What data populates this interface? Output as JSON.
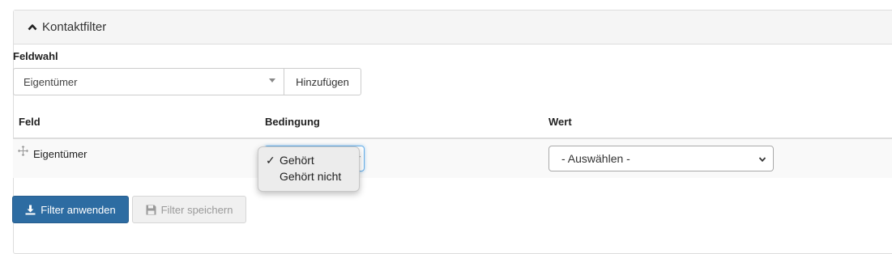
{
  "panel": {
    "title": "Kontaktfilter",
    "header_icon": "chevron-up-icon"
  },
  "field_select": {
    "label": "Feldwahl",
    "value": "Eigentümer",
    "add_button": "Hinzufügen"
  },
  "table": {
    "headers": {
      "feld": "Feld",
      "bedingung": "Bedingung",
      "wert": "Wert"
    },
    "rows": [
      {
        "feld": "Eigentümer",
        "bedingung_options": [
          "Gehört",
          "Gehört nicht"
        ],
        "bedingung_selected": "Gehört",
        "wert": "- Auswählen -"
      }
    ]
  },
  "buttons": {
    "apply": "Filter anwenden",
    "save": "Filter speichern"
  },
  "colors": {
    "primary": "#2d6ca2",
    "focus": "#66afe9"
  }
}
